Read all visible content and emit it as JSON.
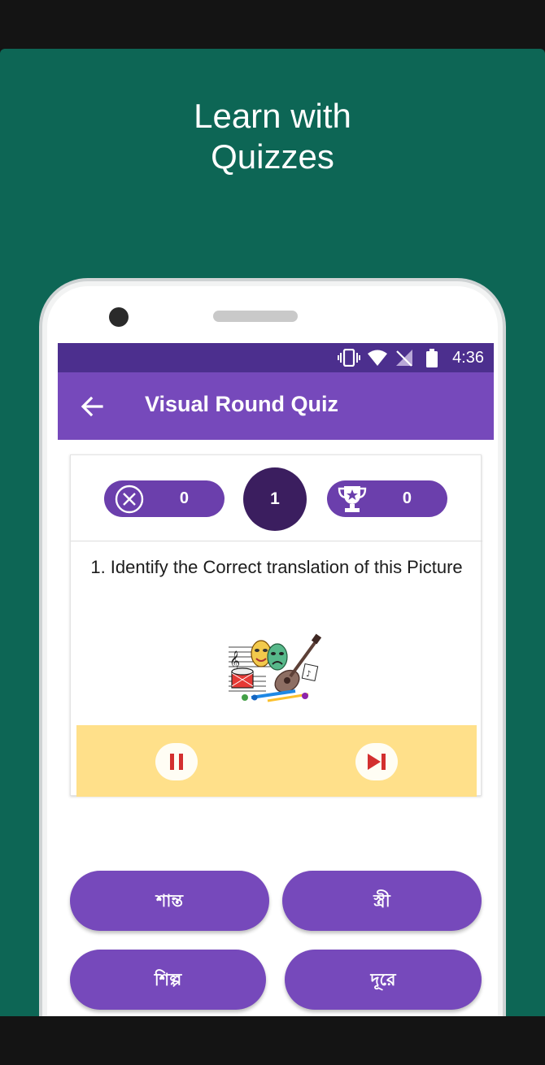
{
  "promo": {
    "headline_line1": "Learn with",
    "headline_line2": "Quizzes"
  },
  "status_bar": {
    "time": "4:36",
    "icons": [
      "vibrate-icon",
      "wifi-icon",
      "no-signal-icon",
      "battery-icon"
    ]
  },
  "app_bar": {
    "title": "Visual Round Quiz",
    "back_icon": "arrow-left-icon"
  },
  "scoreboard": {
    "wrong_count": "0",
    "round_number": "1",
    "score": "0"
  },
  "question": {
    "text": "1. Identify the Correct translation of this Picture",
    "image": "arts-collage-image"
  },
  "controls": {
    "pause_icon": "pause-icon",
    "skip_icon": "skip-next-icon"
  },
  "answers": [
    "শান্ত",
    "স্ত্রী",
    "শিল্প",
    "দূরে"
  ],
  "colors": {
    "background": "#0d6655",
    "primary": "#7649bb",
    "primary_dark": "#4c2f8e",
    "round_circle": "#3b1e5f",
    "pill": "#6b3fac",
    "controls_bg": "#ffe08a",
    "icon_red": "#d32f2f"
  }
}
